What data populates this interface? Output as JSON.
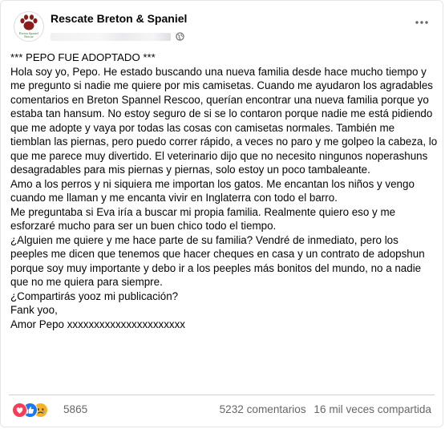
{
  "post": {
    "page_name": "Rescate Breton & Spaniel",
    "avatar_logo_text": "Breton Spaniel Rescue",
    "headline": "*** PEPO FUE ADOPTADO ***",
    "paragraphs": [
      "Hola soy yo, Pepo. He estado buscando una nueva familia desde hace mucho tiempo y me pregunto si nadie me quiere por mis camisetas. Cuando me ayudaron los agradables comentarios en Breton Spannel Rescoo, querían encontrar una nueva familia porque yo estaba tan hansum. No estoy seguro de si se lo contaron porque nadie me está pidiendo que me adopte y vaya por todas las cosas con camisetas normales. También me tiemblan las piernas, pero puedo correr rápido, a veces no paro y me golpeo la cabeza, lo que me parece muy divertido. El veterinario dijo que no necesito ningunos noperashuns desagradables para mis piernas y piernas, solo estoy un poco tambaleante.",
      "Amo a los perros y ni siquiera me importan los gatos. Me encantan los niños y vengo cuando me llaman y me encanta vivir en Inglaterra con todo el barro.",
      "Me preguntaba si Eva iría a buscar mi propia familia. Realmente quiero eso y me esforzaré mucho para ser un buen chico todo el tiempo.",
      "¿Alguien me quiere y me hace parte de su familia? Vendré de inmediato, pero los peeples me dicen que tenemos que hacer cheques en casa y un contrato de adopshun porque soy muy importante y debo ir a los peeples más bonitos del mundo, no a nadie que no me quiera para siempre.",
      "¿Compartirás yooz mi publicación?",
      "Fank yoo,",
      "Amor Pepo xxxxxxxxxxxxxxxxxxxxxx"
    ]
  },
  "footer": {
    "reaction_count": "5865",
    "comments": "5232 comentarios",
    "shares": "16 mil veces compartida",
    "reactions": [
      "love-reaction",
      "like-reaction",
      "sad-reaction"
    ]
  },
  "icons": {
    "privacy": "globe-icon",
    "more": "more-options-icon"
  },
  "colors": {
    "like": "#1877f2",
    "love": "#f33e58",
    "sad": "#f7b125",
    "secondary_text": "#65676b"
  }
}
